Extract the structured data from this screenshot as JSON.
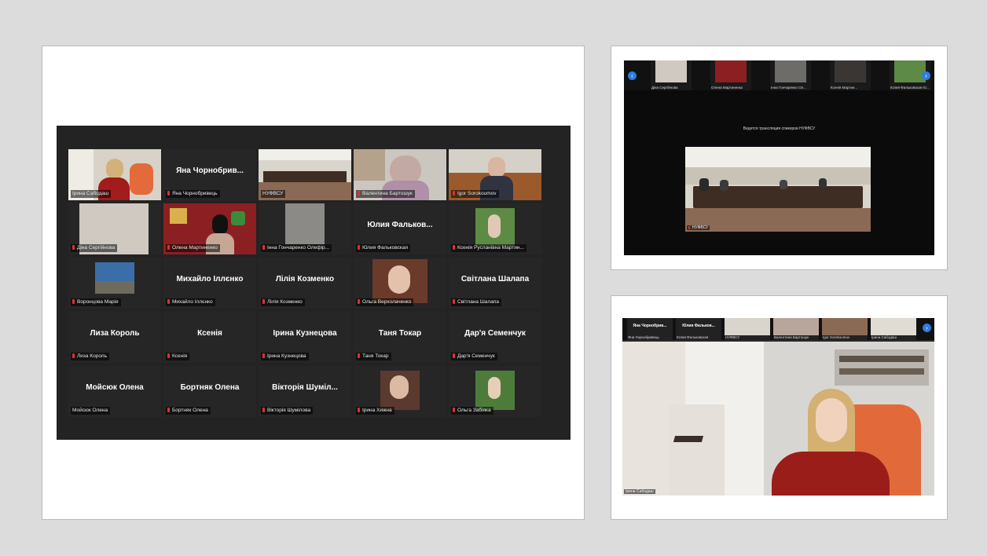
{
  "gallery": {
    "tiles": [
      {
        "name": "",
        "label": "Ірина Сабодаш",
        "mic_muted": false,
        "active": true,
        "kind": "video-woman-office"
      },
      {
        "name": "Яна Чорнобрив...",
        "label": "Яна Чорнобривець",
        "mic_muted": true,
        "active": false,
        "kind": "name"
      },
      {
        "name": "",
        "label": "НУФВСУ",
        "mic_muted": false,
        "active": false,
        "kind": "video-room"
      },
      {
        "name": "",
        "label": "Валентина Бартошук",
        "mic_muted": true,
        "active": false,
        "kind": "video-woman"
      },
      {
        "name": "",
        "label": "Igor Sorokoumov",
        "mic_muted": true,
        "active": false,
        "kind": "video-man"
      },
      {
        "name": "",
        "label": "Діна Сергійнова",
        "mic_muted": true,
        "active": false,
        "kind": "video-wall"
      },
      {
        "name": "",
        "label": "Олена Мартиненко",
        "mic_muted": true,
        "active": false,
        "kind": "video-red"
      },
      {
        "name": "",
        "label": "Інна Гончаренко Олефір...",
        "mic_muted": true,
        "active": false,
        "kind": "photo-gray"
      },
      {
        "name": "Юлия Фальков...",
        "label": "Юлия Фальковская",
        "mic_muted": true,
        "active": false,
        "kind": "name"
      },
      {
        "name": "",
        "label": "Ксенія Русланівна Мартин...",
        "mic_muted": true,
        "active": false,
        "kind": "photo-green"
      },
      {
        "name": "",
        "label": "Воронцова Марія",
        "mic_muted": true,
        "active": false,
        "kind": "photo-sea"
      },
      {
        "name": "Михайло Іллєнко",
        "label": "Михайло Іллєнко",
        "mic_muted": true,
        "active": false,
        "kind": "name"
      },
      {
        "name": "Лілія Козменко",
        "label": "Лілія Козменко",
        "mic_muted": true,
        "active": false,
        "kind": "name"
      },
      {
        "name": "",
        "label": "Ольга Верхолаченко",
        "mic_muted": true,
        "active": false,
        "kind": "photo-portrait"
      },
      {
        "name": "Світлана Шалапа",
        "label": "Світлана Шалапа",
        "mic_muted": true,
        "active": false,
        "kind": "name"
      },
      {
        "name": "Лиза Король",
        "label": "Лиза Король",
        "mic_muted": true,
        "active": false,
        "kind": "name"
      },
      {
        "name": "Ксенія",
        "label": "Ксенія",
        "mic_muted": true,
        "active": false,
        "kind": "name"
      },
      {
        "name": "Ірина Кузнецова",
        "label": "Ірина Кузнецова",
        "mic_muted": true,
        "active": false,
        "kind": "name"
      },
      {
        "name": "Таня Токар",
        "label": "Таня Токар",
        "mic_muted": true,
        "active": false,
        "kind": "name"
      },
      {
        "name": "Дар'я Семенчук",
        "label": "Дар'я Семенчук",
        "mic_muted": true,
        "active": false,
        "kind": "name"
      },
      {
        "name": "Мойсюк Олена",
        "label": "Мойсюк Олена",
        "mic_muted": false,
        "active": false,
        "kind": "name"
      },
      {
        "name": "Бортняк Олена",
        "label": "Бортняк Олена",
        "mic_muted": true,
        "active": false,
        "kind": "name"
      },
      {
        "name": "Вікторія Шуміл...",
        "label": "Вікторія Шумілова",
        "mic_muted": true,
        "active": false,
        "kind": "name"
      },
      {
        "name": "",
        "label": "Ірина Хижна",
        "mic_muted": true,
        "active": false,
        "kind": "photo-portrait2"
      },
      {
        "name": "",
        "label": "Ольга Забіяка",
        "mic_muted": true,
        "active": false,
        "kind": "photo-green2"
      }
    ]
  },
  "top_right": {
    "strip": [
      {
        "label": "Діна Сергійнова",
        "kind": "wall"
      },
      {
        "label": "Олена Мартиненко",
        "kind": "red"
      },
      {
        "label": "Інна Гончаренко Ол...",
        "kind": "gray"
      },
      {
        "label": "Ксенія Мартин...",
        "kind": "dark"
      },
      {
        "label": "Юлия Фальковская Ю...",
        "kind": "green"
      }
    ],
    "caption": "Ведется трансляция спикеров НУФВСУ",
    "main_label": "НУФВСУ"
  },
  "bottom_right": {
    "strip": [
      {
        "name": "Яна Чорнобрив...",
        "label": "Яна Чорнобривець",
        "kind": "name"
      },
      {
        "name": "Юлия Фальков...",
        "label": "Юлия Фальковская",
        "kind": "name"
      },
      {
        "name": "",
        "label": "НУФВСУ",
        "kind": "room"
      },
      {
        "name": "",
        "label": "Валентина Бартошук",
        "kind": "woman"
      },
      {
        "name": "",
        "label": "Igor Sorokoumov",
        "kind": "man"
      },
      {
        "name": "",
        "label": "Ірина Сабодаш",
        "kind": "wall"
      }
    ],
    "speaker_label": "Ірина Сабодаш"
  },
  "icons": {
    "prev": "chevron-left-icon",
    "next": "chevron-right-icon",
    "mic": "mic-muted-icon"
  },
  "colors": {
    "active_border": "#b7d94b",
    "mic_muted": "#e03030",
    "nav_arrow": "#2e7de0"
  }
}
